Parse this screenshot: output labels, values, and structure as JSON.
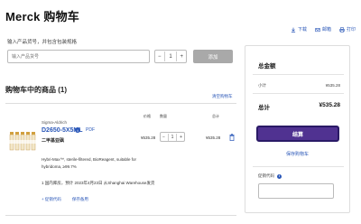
{
  "page": {
    "title": "Merck 购物车"
  },
  "toolbar": {
    "download": "下载",
    "email": "邮箱",
    "print": "打印"
  },
  "add_product": {
    "label": "输入产品货号，并包含包装规格",
    "placeholder": "输入产品货号",
    "quantity": "1",
    "minus": "−",
    "plus": "+",
    "add_label": "添加"
  },
  "cart": {
    "heading": "购物车中的商品 (1)",
    "clear_label": "清空购物车",
    "columns": {
      "price": "价格",
      "qty": "数量",
      "total": "总计"
    },
    "item": {
      "brand": "Sigma-Aldrich",
      "sku": "D2650-5X5ML",
      "pdf_label": "PDF",
      "name": "二甲基亚砜",
      "description": "Hybri-Max™, sterile-filtered, BioReagent, suitable for hybridoma, ≥99.7%",
      "price": "¥535.28",
      "quantity": "1",
      "total": "¥535.28",
      "shipping_note": "1 国内库房，预计 2023年4月23日 从Shanghai Warehouse发货",
      "add_to_list": "+ 促销代码",
      "save_for_later": "保存备用"
    }
  },
  "summary": {
    "title": "总金额",
    "subtotal_label": "小计",
    "subtotal_value": "¥535.28",
    "total_label": "总计",
    "total_value": "¥535.28",
    "checkout_label": "结算",
    "save_cart_label": "保存购物车",
    "promo_label": "促销代码"
  },
  "colors": {
    "brand_purple": "#503291",
    "link_blue": "#2a57b8",
    "add_button_gray": "#a9a9a9"
  }
}
